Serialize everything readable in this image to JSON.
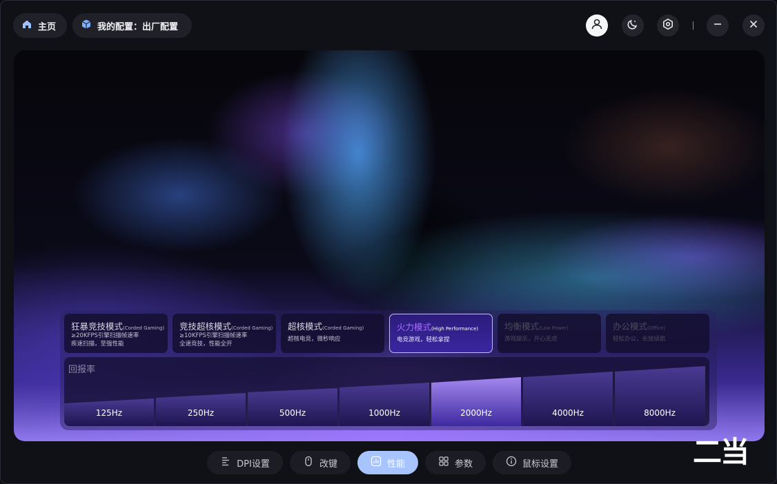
{
  "topbar": {
    "home_label": "主页",
    "config_label": "我的配置：出厂配置"
  },
  "modes": [
    {
      "title": "狂暴竞技模式",
      "tag": "(Corded Gaming)",
      "desc1": "≥20KFPS引擎扫描帧速率",
      "desc2": "疾速扫描，至强性能",
      "state": "normal"
    },
    {
      "title": "竞技超核模式",
      "tag": "(Corded Gaming)",
      "desc1": "≥10KFPS引擎扫描帧速率",
      "desc2": "全速竞技，性能全开",
      "state": "normal"
    },
    {
      "title": "超核模式",
      "tag": "(Corded Gaming)",
      "desc1": "超核电竞，微秒响应",
      "desc2": "",
      "state": "normal"
    },
    {
      "title": "火力模式",
      "tag": "(High Performance)",
      "desc1": "电竞游戏，轻松拿捏",
      "desc2": "",
      "state": "active"
    },
    {
      "title": "均衡模式",
      "tag": "(Low Power)",
      "desc1": "游戏娱乐，开心无虑",
      "desc2": "",
      "state": "dim"
    },
    {
      "title": "办公模式",
      "tag": "(Office)",
      "desc1": "轻松办公，长效续航",
      "desc2": "",
      "state": "dim"
    }
  ],
  "polling": {
    "title": "回报率",
    "rates": [
      "125Hz",
      "250Hz",
      "500Hz",
      "1000Hz",
      "2000Hz",
      "4000Hz",
      "8000Hz"
    ],
    "selected": "2000Hz"
  },
  "watermark": "二当",
  "nav": {
    "dpi": "DPI设置",
    "remap": "改键",
    "performance": "性能",
    "params": "参数",
    "mouse": "鼠标设置",
    "active": "性能"
  },
  "colors": {
    "accent": "#a8c4ff",
    "active_mode_border": "#c6bdfc",
    "active_mode_title": "#a86bff"
  }
}
